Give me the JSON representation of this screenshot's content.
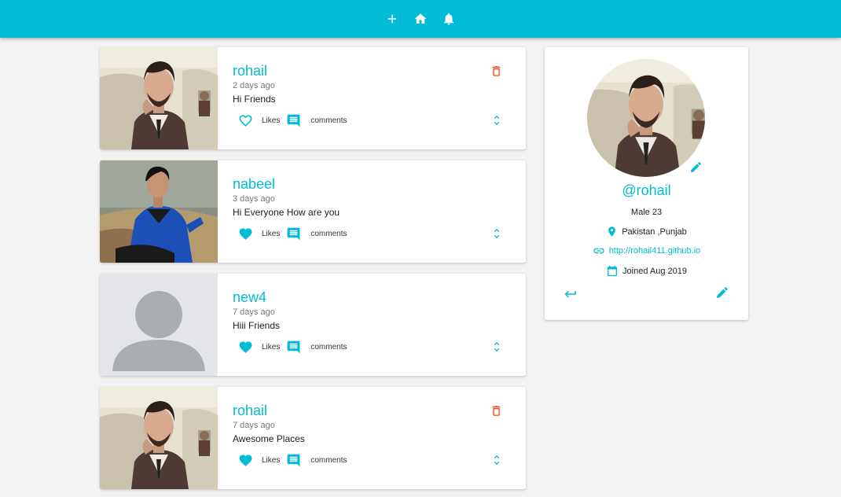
{
  "navbar": {
    "icons": [
      "add-icon",
      "home-icon",
      "bell-icon"
    ],
    "accent_color": "#00bcd4"
  },
  "posts": [
    {
      "username": "rohail",
      "time": "2 days ago",
      "body": "Hi Friends",
      "likes_label": "Likes",
      "comments_label": "comments",
      "liked": false,
      "deletable": true,
      "photo": "man-in-suit"
    },
    {
      "username": "nabeel",
      "time": "3 days ago",
      "body": "Hi Everyone How are you",
      "likes_label": "Likes",
      "comments_label": "comments",
      "liked": true,
      "deletable": false,
      "photo": "man-in-blue-jacket"
    },
    {
      "username": "new4",
      "time": "7 days ago",
      "body": "Hiii Friends",
      "likes_label": "Likes",
      "comments_label": "comments",
      "liked": true,
      "deletable": false,
      "photo": "default-avatar"
    },
    {
      "username": "rohail",
      "time": "7 days ago",
      "body": "Awesome Places",
      "likes_label": "Likes",
      "comments_label": "comments",
      "liked": true,
      "deletable": true,
      "photo": "man-in-suit"
    }
  ],
  "profile": {
    "handle": "@rohail",
    "gender_age": "Male 23",
    "location": "Pakistan ,Punjab",
    "website": "http://rohail411.github.io",
    "joined": "Joined Aug 2019"
  },
  "colors": {
    "accent": "#00bcd4",
    "delete": "#f4511e",
    "background": "#f3f3f3"
  }
}
